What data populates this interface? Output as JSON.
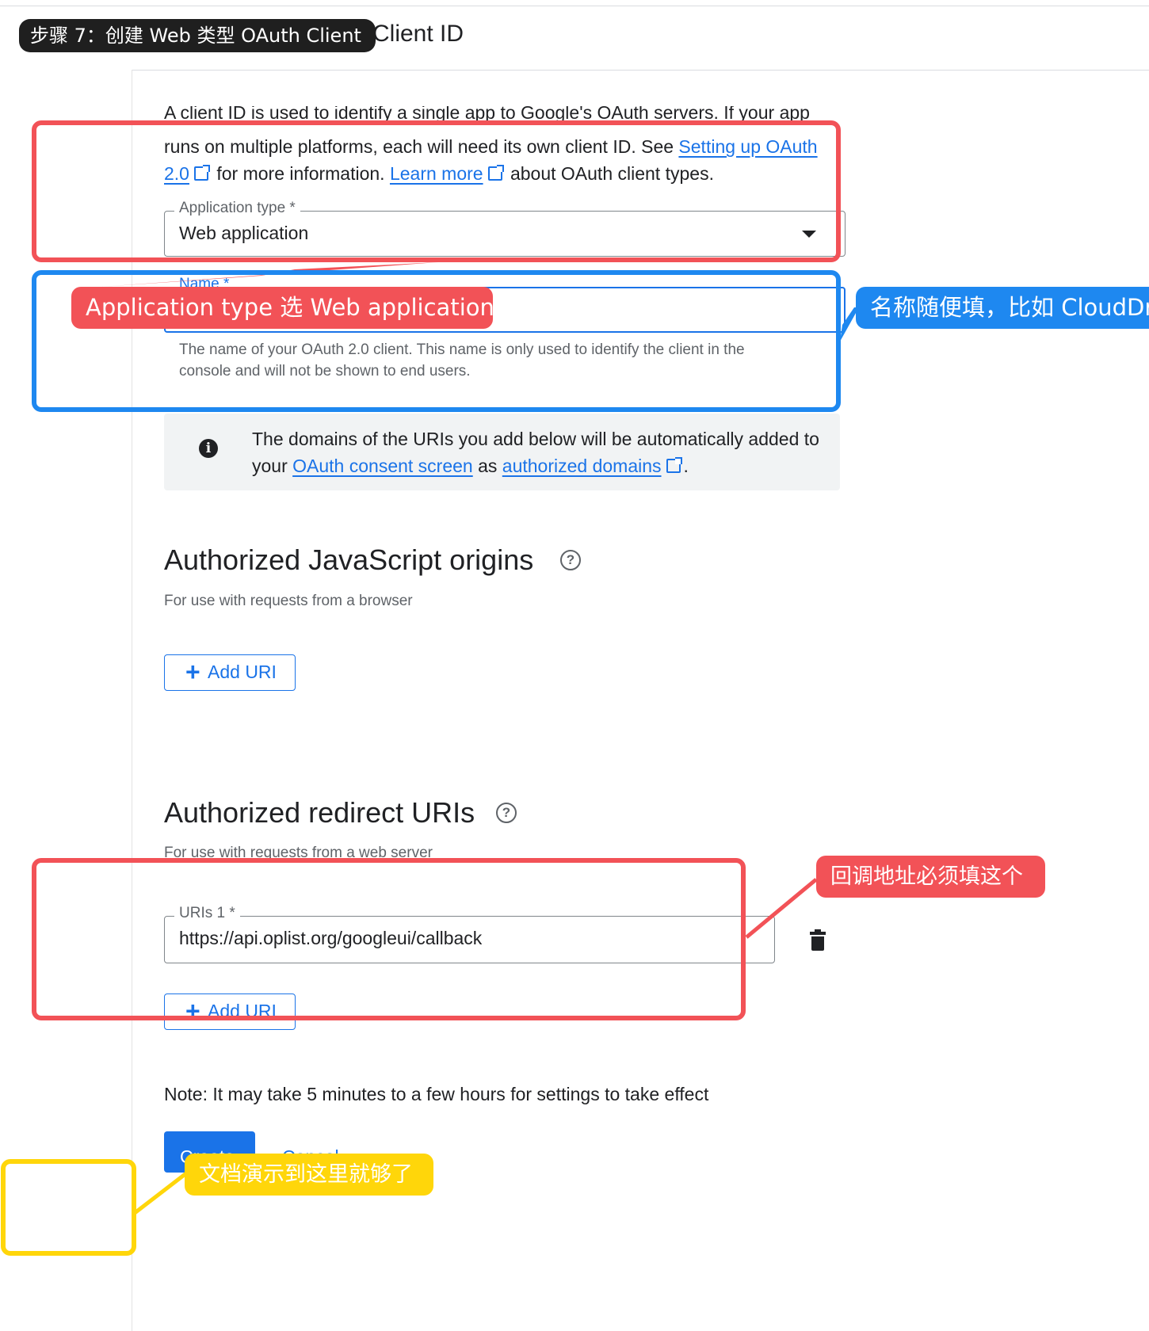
{
  "page": {
    "title": "Client ID"
  },
  "step_badge": "步骤 7：创建 Web 类型 OAuth Client",
  "intro": {
    "line1": "A client ID is used to identify a single app to Google's OAuth servers. If your app",
    "line2_prefix": "runs on multiple platforms, each will need its own client ID. See ",
    "link1_part1": "Setting up OAuth",
    "link1_part2": "2.0",
    "mid": " for more information. ",
    "link2": "Learn more",
    "suffix": " about OAuth client types."
  },
  "application_type": {
    "label": "Application type *",
    "value": "Web application"
  },
  "name_field": {
    "label": "Name *",
    "value": "",
    "help": "The name of your OAuth 2.0 client. This name is only used to identify the client in the console and will not be shown to end users."
  },
  "info": {
    "prefix": "The domains of the URIs you add below will be automatically added to your ",
    "link1": "OAuth consent screen",
    "mid": " as ",
    "link2": "authorized domains",
    "suffix": "."
  },
  "js_origins": {
    "title": "Authorized JavaScript origins",
    "subtitle": "For use with requests from a browser",
    "add_label": "Add URI"
  },
  "redirect_uris": {
    "title": "Authorized redirect URIs",
    "subtitle": "For use with requests from a web server",
    "field_label": "URIs 1 *",
    "field_value": "https://api.oplist.org/googleui/callback",
    "add_label": "Add URI"
  },
  "note": "Note: It may take 5 minutes to a few hours for settings to take effect",
  "buttons": {
    "create": "Create",
    "cancel": "Cancel"
  },
  "annotations": {
    "app_type": "Application type 选 Web application",
    "name": "名称随便填，比如 CloudDri",
    "redirect": "回调地址必须填这个",
    "enough": "文档演示到这里就够了"
  },
  "colors": {
    "primary": "#1a73e8",
    "annotation_red": "#f25257",
    "annotation_blue": "#1e88f0",
    "annotation_yellow": "#ffd60a"
  },
  "icons": {
    "dropdown": "caret-down-icon",
    "external_link": "external-link-icon",
    "info": "info-icon",
    "help": "help-circle-icon",
    "add": "plus-icon",
    "delete": "trash-icon"
  }
}
